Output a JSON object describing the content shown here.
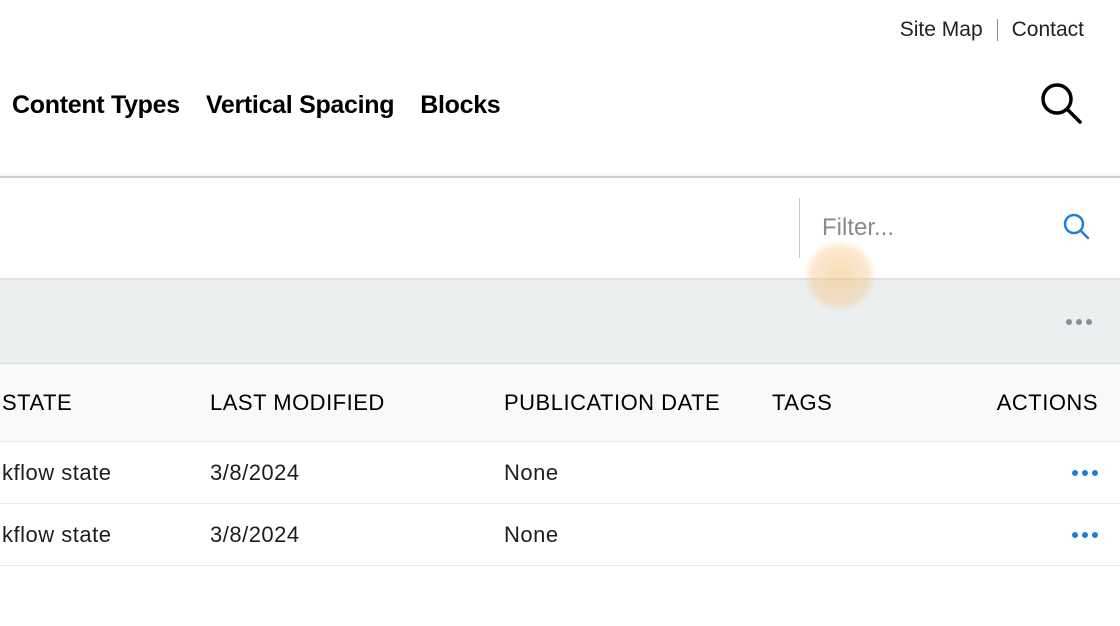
{
  "utility": {
    "sitemap": "Site Map",
    "contact": "Contact"
  },
  "nav": {
    "tabs": [
      "Content Types",
      "Vertical Spacing",
      "Blocks"
    ]
  },
  "filter": {
    "placeholder": "Filter..."
  },
  "table": {
    "headers": {
      "state": "STATE",
      "last_modified": "LAST MODIFIED",
      "publication_date": "PUBLICATION DATE",
      "tags": "TAGS",
      "actions": "ACTIONS"
    },
    "rows": [
      {
        "state": "kflow state",
        "last_modified": "3/8/2024",
        "publication_date": "None",
        "tags": ""
      },
      {
        "state": "kflow state",
        "last_modified": "3/8/2024",
        "publication_date": "None",
        "tags": ""
      }
    ]
  }
}
